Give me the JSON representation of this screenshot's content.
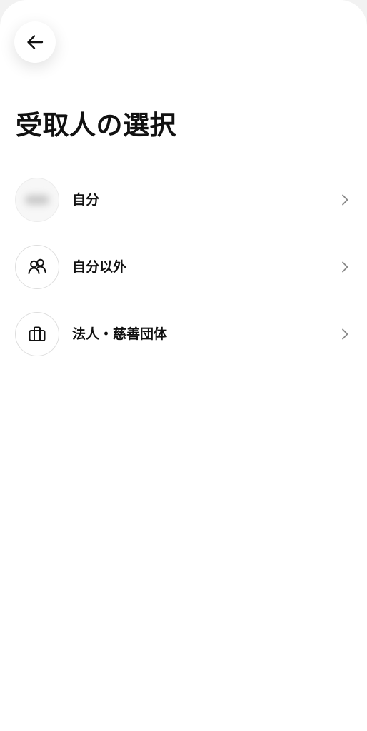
{
  "header": {
    "back_icon": "arrow-left-icon",
    "title": "受取人の選択"
  },
  "options": [
    {
      "label": "自分",
      "icon": "blurred-avatar"
    },
    {
      "label": "自分以外",
      "icon": "people-icon"
    },
    {
      "label": "法人・慈善団体",
      "icon": "briefcase-icon"
    }
  ],
  "colors": {
    "background": "#ffffff",
    "text": "#111111",
    "border": "#dedede",
    "chevron": "#8a8a8a"
  }
}
